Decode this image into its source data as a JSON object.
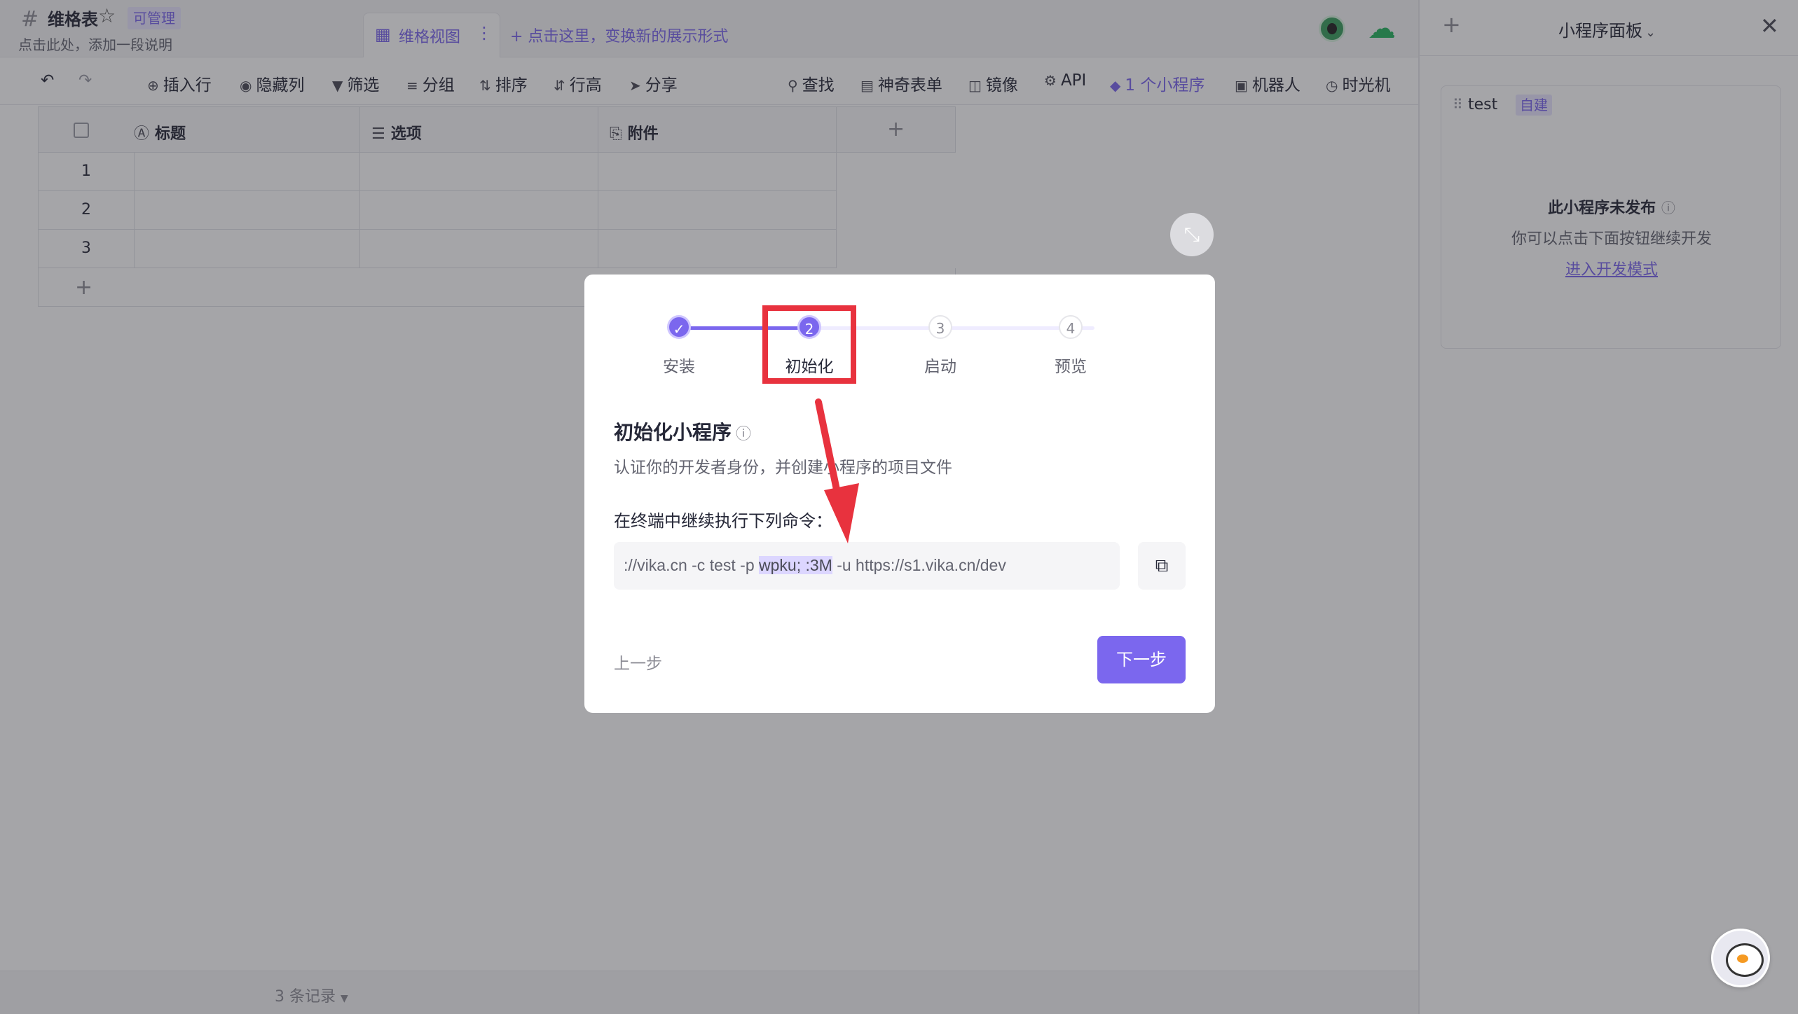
{
  "header": {
    "sheet_title": "维格表",
    "permission_badge": "可管理",
    "description": "点击此处，添加一段说明",
    "view_tab_label": "维格视图",
    "add_view_label": "+ 点击这里，变换新的展示形式"
  },
  "toolbar": {
    "insert_row": "插入行",
    "hide_columns": "隐藏列",
    "filter": "筛选",
    "group": "分组",
    "sort": "排序",
    "row_height": "行高",
    "share": "分享",
    "find": "查找",
    "magic_form": "神奇表单",
    "mirror": "镜像",
    "api": "API",
    "widgets": "1 个小程序",
    "robot": "机器人",
    "time_machine": "时光机"
  },
  "grid": {
    "columns": [
      "标题",
      "选项",
      "附件"
    ],
    "row_numbers": [
      "1",
      "2",
      "3"
    ],
    "add_symbol": "+"
  },
  "footer": {
    "record_count": "3 条记录"
  },
  "panel": {
    "title": "小程序面板",
    "widget_name": "test",
    "self_built_badge": "自建",
    "unpublished_text": "此小程序未发布",
    "hint_text": "你可以点击下面按钮继续开发",
    "dev_mode_link": "进入开发模式"
  },
  "modal": {
    "steps": [
      {
        "number": "✓",
        "label": "安装",
        "state": "done"
      },
      {
        "number": "2",
        "label": "初始化",
        "state": "current"
      },
      {
        "number": "3",
        "label": "启动",
        "state": "todo"
      },
      {
        "number": "4",
        "label": "预览",
        "state": "todo"
      }
    ],
    "title": "初始化小程序",
    "description": "认证你的开发者身份，并创建小程序的项目文件",
    "command_label": "在终端中继续执行下列命令：",
    "command_prefix": "://vika.cn -c test -p ",
    "command_token": "wpku;        :3M",
    "command_suffix": " -u https://s1.vika.cn/dev",
    "prev_label": "上一步",
    "next_label": "下一步"
  },
  "colors": {
    "accent": "#7b67ee",
    "annotation_red": "#e8323e",
    "overlay": "rgba(40,40,48,0.42)"
  },
  "icons": [
    "hash-icon",
    "star-icon",
    "grid-view-icon",
    "more-icon",
    "avatar",
    "cloud-sync-icon",
    "undo-icon",
    "redo-icon",
    "help-icon",
    "copy-icon",
    "collapse-icon",
    "close-icon",
    "chevron-down-icon"
  ]
}
